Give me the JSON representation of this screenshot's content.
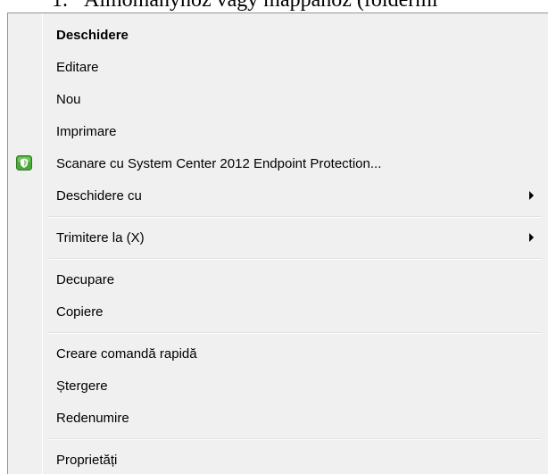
{
  "background": {
    "heading_number": "1.",
    "heading_text": "Almomanyhoz vagy mappához (fóldermi"
  },
  "menu": {
    "groups": [
      [
        {
          "label": "Deschidere",
          "bold": true
        },
        {
          "label": "Editare"
        },
        {
          "label": "Nou"
        },
        {
          "label": "Imprimare"
        },
        {
          "label": "Scanare cu System Center 2012 Endpoint Protection...",
          "icon": "endpoint-protection-shield-icon"
        },
        {
          "label": "Deschidere cu",
          "submenu": true
        }
      ],
      [
        {
          "label": "Trimitere la (X)",
          "submenu": true
        }
      ],
      [
        {
          "label": "Decupare"
        },
        {
          "label": "Copiere"
        }
      ],
      [
        {
          "label": "Creare comandă rapidă"
        },
        {
          "label": "Ștergere"
        },
        {
          "label": "Redenumire"
        }
      ],
      [
        {
          "label": "Proprietăți"
        }
      ]
    ]
  },
  "colors": {
    "menu_background": "#f0f0f0",
    "border": "#979797",
    "icon_green": "#4aa83a"
  }
}
